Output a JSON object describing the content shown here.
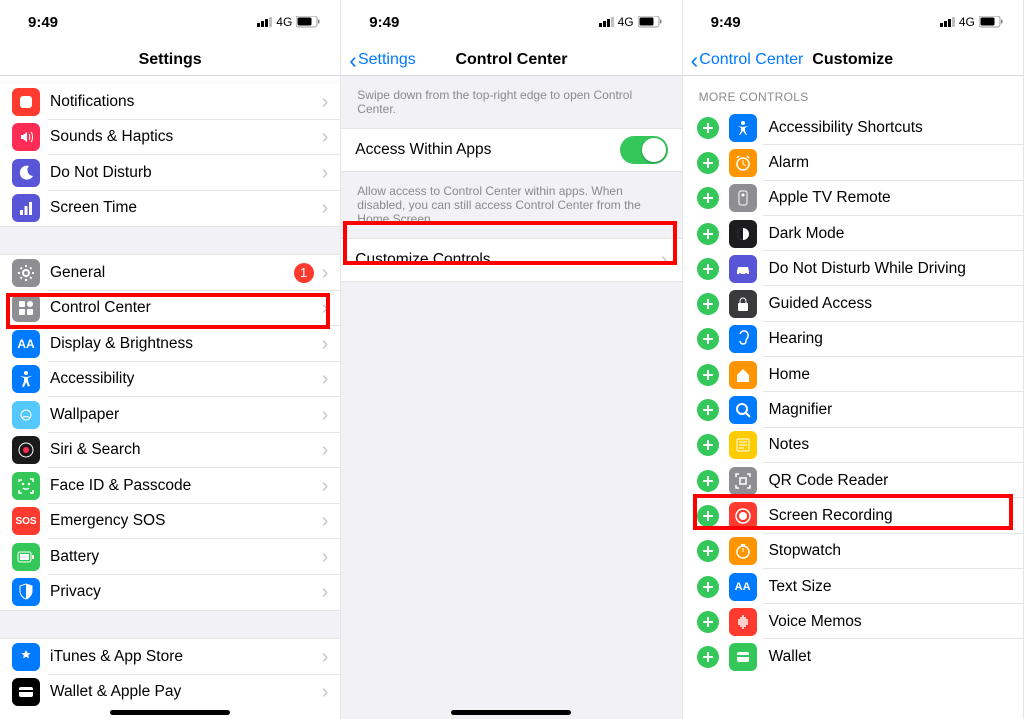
{
  "status": {
    "time": "9:49",
    "net": "4G"
  },
  "screen1": {
    "title": "Settings",
    "items_a": [
      {
        "label": "Notifications",
        "bg": "#ff3b30"
      },
      {
        "label": "Sounds & Haptics",
        "bg": "#ff2d55"
      },
      {
        "label": "Do Not Disturb",
        "bg": "#5856d6"
      },
      {
        "label": "Screen Time",
        "bg": "#5856d6"
      }
    ],
    "items_b": [
      {
        "label": "General",
        "bg": "#8e8e93",
        "badge": "1"
      },
      {
        "label": "Control Center",
        "bg": "#8e8e93"
      },
      {
        "label": "Display & Brightness",
        "bg": "#007aff"
      },
      {
        "label": "Accessibility",
        "bg": "#007aff"
      },
      {
        "label": "Wallpaper",
        "bg": "#54c7fc"
      },
      {
        "label": "Siri & Search",
        "bg": "#1a1a1a"
      },
      {
        "label": "Face ID & Passcode",
        "bg": "#34c759"
      },
      {
        "label": "Emergency SOS",
        "bg": "#ff3b30"
      },
      {
        "label": "Battery",
        "bg": "#34c759"
      },
      {
        "label": "Privacy",
        "bg": "#007aff"
      }
    ],
    "items_c": [
      {
        "label": "iTunes & App Store",
        "bg": "#007aff"
      },
      {
        "label": "Wallet & Apple Pay",
        "bg": "#000"
      }
    ]
  },
  "screen2": {
    "back": "Settings",
    "title": "Control Center",
    "hint1": "Swipe down from the top-right edge to open Control Center.",
    "toggle_label": "Access Within Apps",
    "hint2": "Allow access to Control Center within apps. When disabled, you can still access Control Center from the Home Screen.",
    "customize": "Customize Controls"
  },
  "screen3": {
    "back": "Control Center",
    "title": "Customize",
    "header": "MORE CONTROLS",
    "items": [
      {
        "label": "Accessibility Shortcuts",
        "bg": "#007aff"
      },
      {
        "label": "Alarm",
        "bg": "#ff9500"
      },
      {
        "label": "Apple TV Remote",
        "bg": "#8e8e93"
      },
      {
        "label": "Dark Mode",
        "bg": "#1c1c1e"
      },
      {
        "label": "Do Not Disturb While Driving",
        "bg": "#5856d6"
      },
      {
        "label": "Guided Access",
        "bg": "#3a3a3c"
      },
      {
        "label": "Hearing",
        "bg": "#007aff"
      },
      {
        "label": "Home",
        "bg": "#ff9500"
      },
      {
        "label": "Magnifier",
        "bg": "#007aff"
      },
      {
        "label": "Notes",
        "bg": "#ffcc00"
      },
      {
        "label": "QR Code Reader",
        "bg": "#8e8e93"
      },
      {
        "label": "Screen Recording",
        "bg": "#ff3b30"
      },
      {
        "label": "Stopwatch",
        "bg": "#ff9500"
      },
      {
        "label": "Text Size",
        "bg": "#007aff"
      },
      {
        "label": "Voice Memos",
        "bg": "#ff3b30"
      },
      {
        "label": "Wallet",
        "bg": "#34c759"
      }
    ]
  }
}
